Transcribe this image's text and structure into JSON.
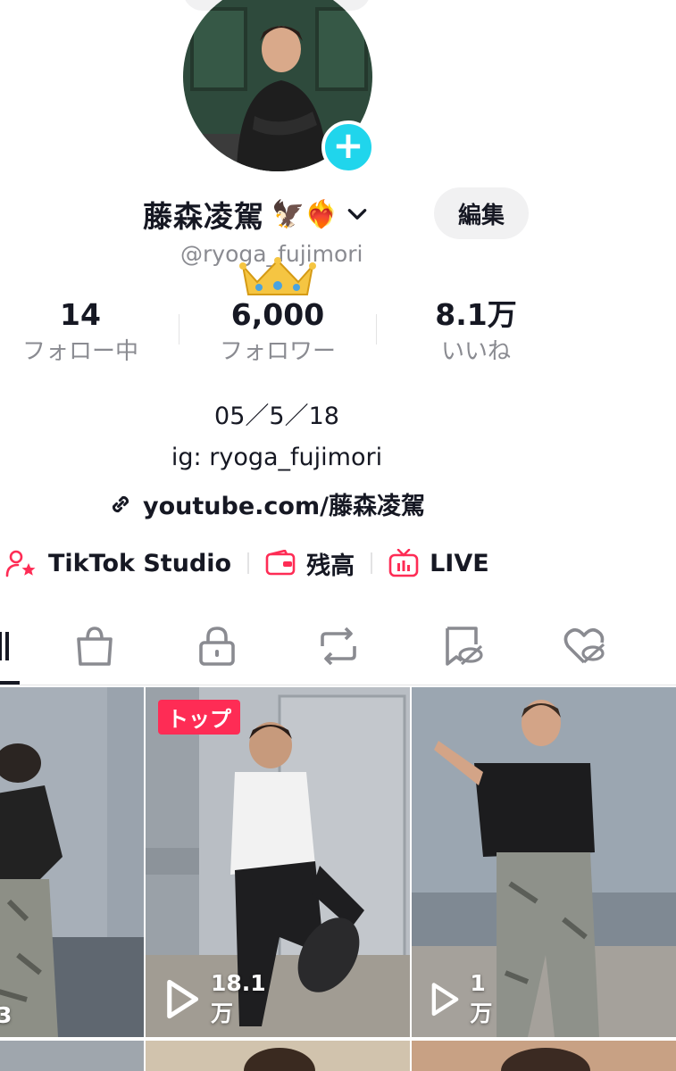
{
  "profile": {
    "display_name": "藤森凌駕",
    "name_emojis": "🦅❤️‍🔥",
    "username": "@ryoga_fujimori",
    "username_emoji": "👑",
    "edit_label": "編集"
  },
  "stats": [
    {
      "value": "14",
      "label": "フォロー中"
    },
    {
      "value": "6,000",
      "label": "フォロワー"
    },
    {
      "value": "8.1万",
      "label": "いいね"
    }
  ],
  "bio": {
    "line1": "05／5／18",
    "line2": "ig: ryoga_fujimori",
    "link": "youtube.com/藤森凌駕"
  },
  "tools": {
    "studio": "TikTok Studio",
    "balance": "残高",
    "live": "LIVE"
  },
  "tabs": [
    "videos",
    "shop",
    "private",
    "reposts",
    "tagged",
    "liked"
  ],
  "videos": [
    {
      "views": "3",
      "pinned": false
    },
    {
      "views": "18.1万",
      "pinned": true,
      "pin_label": "トップ"
    },
    {
      "views": "1万",
      "pinned": false
    }
  ],
  "colors": {
    "accent": "#fe2c55",
    "add_button": "#20d5ec",
    "text": "#161823",
    "muted": "#8a8b91"
  }
}
